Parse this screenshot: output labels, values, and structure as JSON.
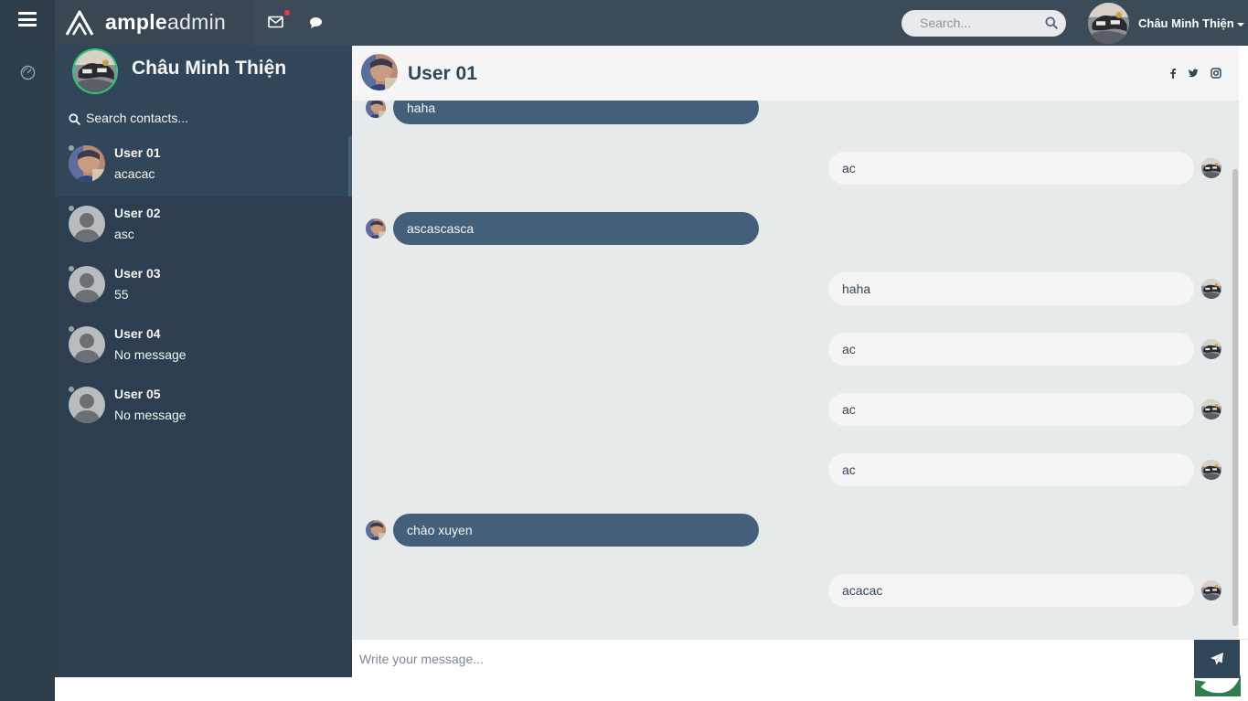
{
  "app": {
    "brand_bold": "ample",
    "brand_light": "admin"
  },
  "colors": {
    "accent": "#435f7a",
    "online": "#2ecc71",
    "panel": "#2c3e50",
    "notify": "#f33155"
  },
  "topbar": {
    "icons": [
      "menu-icon",
      "mail-icon",
      "chat-icon"
    ],
    "search_placeholder": "Search...",
    "username": "Châu Minh Thiện"
  },
  "rail": {
    "icons": [
      "dashboard-icon"
    ]
  },
  "profile": {
    "name": "Châu Minh Thiện"
  },
  "contacts": {
    "search_placeholder": "Search contacts...",
    "items": [
      {
        "name": "User 01",
        "preview": "acacac"
      },
      {
        "name": "User 02",
        "preview": "asc"
      },
      {
        "name": "User 03",
        "preview": "55"
      },
      {
        "name": "User 04",
        "preview": "No message"
      },
      {
        "name": "User 05",
        "preview": "No message"
      }
    ]
  },
  "chat": {
    "title": "User 01",
    "social_icons": [
      "facebook-icon",
      "twitter-icon",
      "instagram-icon"
    ],
    "messages": [
      {
        "dir": "recv",
        "text": "haha"
      },
      {
        "dir": "sent",
        "text": "ac"
      },
      {
        "dir": "recv",
        "text": "ascascasca"
      },
      {
        "dir": "sent",
        "text": "haha"
      },
      {
        "dir": "sent",
        "text": "ac"
      },
      {
        "dir": "sent",
        "text": "ac"
      },
      {
        "dir": "sent",
        "text": "ac"
      },
      {
        "dir": "recv",
        "text": "chào xuyen"
      },
      {
        "dir": "sent",
        "text": "acacac"
      }
    ]
  },
  "composer": {
    "placeholder": "Write your message...",
    "send_icon": "paper-plane-icon"
  }
}
